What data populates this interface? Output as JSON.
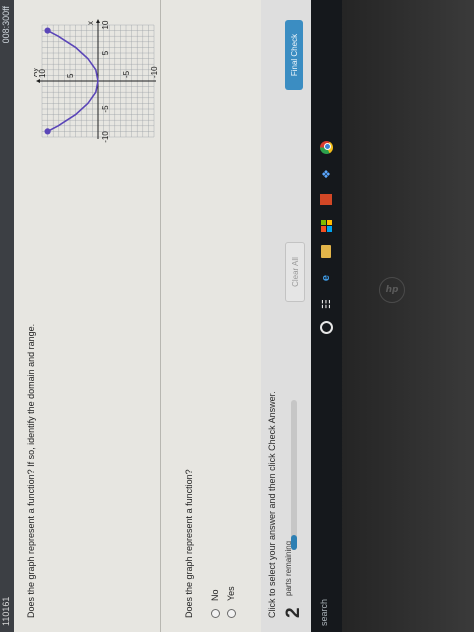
{
  "topbar": {
    "label": "110161",
    "user": "008:300ff"
  },
  "question": {
    "text": "Does the graph represent a function? If so, identify the domain and range."
  },
  "graph": {
    "y_axis_label": "Ay",
    "x_axis_label": "x",
    "x_tick_labels": [
      "-10",
      "-5",
      "5",
      "10"
    ],
    "y_tick_labels": [
      "10",
      "5",
      "-5",
      "-10"
    ],
    "curve_color": "#5b46b8",
    "axis_color": "#1e1e1e"
  },
  "chart_data": {
    "type": "line",
    "x": [
      -9,
      -8,
      -6,
      -4,
      -2,
      0,
      2,
      4,
      6,
      8,
      9
    ],
    "series": [
      {
        "values": [
          9,
          7.1,
          4,
          1.8,
          0.4,
          0,
          0.4,
          1.8,
          4,
          7.1,
          9
        ]
      }
    ],
    "endpoints": [
      {
        "x": -9,
        "y": 9,
        "closed": true
      },
      {
        "x": 9,
        "y": 9,
        "closed": true
      }
    ],
    "xlim": [
      -10,
      10
    ],
    "ylim": [
      -10,
      10
    ],
    "grid": true,
    "xlabel": "x",
    "ylabel": "Ay"
  },
  "prompt": {
    "text": "Does the graph represent a function?"
  },
  "options": [
    {
      "label": "No"
    },
    {
      "label": "Yes"
    }
  ],
  "footer": {
    "instructions": "Click to select your answer and then click Check Answer.",
    "parts_count": "2",
    "parts_label": "parts remaining",
    "progress": 0.1,
    "clear_all": "Clear All",
    "final_check": "Final Check"
  },
  "taskbar": {
    "search_text": "search",
    "icons": [
      "cortana-icon",
      "task-view-icon",
      "edge-icon",
      "file-explorer-icon",
      "store-icon",
      "office-icon",
      "dropbox-icon",
      "chrome-icon"
    ]
  },
  "bezel": {
    "logo": "hp"
  },
  "colors": {
    "accent": "#3b8dc2",
    "curve": "#5b46b8",
    "taskbar": "#15181c"
  }
}
